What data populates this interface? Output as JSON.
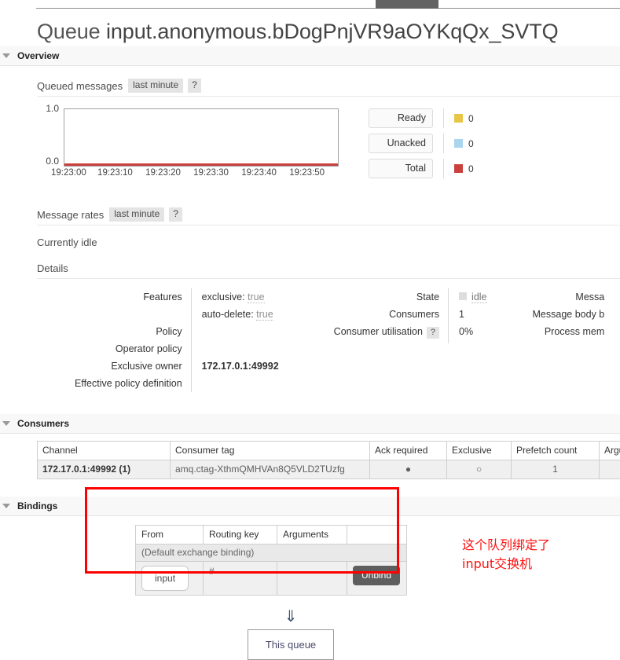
{
  "topbar": {
    "active_tab_marker": ""
  },
  "page": {
    "title_prefix": "Queue",
    "title_name": "input.anonymous.bDogPnjVR9aOYKqQx_SVTQ"
  },
  "overview": {
    "section_label": "Overview",
    "queued_messages": {
      "label": "Queued messages",
      "period_chip": "last minute",
      "help_chip": "?"
    },
    "message_rates": {
      "label": "Message rates",
      "period_chip": "last minute",
      "help_chip": "?"
    },
    "idle_text": "Currently idle",
    "details_label": "Details"
  },
  "chart_data": {
    "type": "line",
    "title": "Queued messages",
    "xlabel": "",
    "ylabel": "",
    "x": [
      "19:23:00",
      "19:23:10",
      "19:23:20",
      "19:23:30",
      "19:23:40",
      "19:23:50"
    ],
    "ytick_labels": [
      "0.0",
      "1.0"
    ],
    "ylim": [
      0,
      1
    ],
    "grid": false,
    "legend_position": "right",
    "series": [
      {
        "name": "Ready",
        "color": "#e8c547",
        "value": "0",
        "values": [
          0,
          0,
          0,
          0,
          0,
          0
        ]
      },
      {
        "name": "Unacked",
        "color": "#a9d5ef",
        "value": "0",
        "values": [
          0,
          0,
          0,
          0,
          0,
          0
        ]
      },
      {
        "name": "Total",
        "color": "#c9403c",
        "value": "0",
        "values": [
          0,
          0,
          0,
          0,
          0,
          0
        ]
      }
    ]
  },
  "details": {
    "col1": {
      "keys": [
        "Features",
        "",
        "Policy",
        "Operator policy",
        "Exclusive owner",
        "Effective policy definition"
      ],
      "values": [
        {
          "key": "exclusive:",
          "val": "true"
        },
        {
          "key": "auto-delete:",
          "val": "true"
        },
        {
          "key": "",
          "val": ""
        },
        {
          "key": "",
          "val": ""
        },
        {
          "key": "172.17.0.1:49992",
          "val": ""
        },
        {
          "key": "",
          "val": ""
        }
      ]
    },
    "col2": {
      "keys": [
        "State",
        "Consumers",
        "Consumer utilisation"
      ],
      "util_help": "?",
      "values": [
        "idle",
        "1",
        "0%"
      ]
    },
    "col3": {
      "keys": [
        "Messa",
        "Message body b",
        "Process mem"
      ]
    }
  },
  "consumers": {
    "section_label": "Consumers",
    "headers": [
      "Channel",
      "Consumer tag",
      "Ack required",
      "Exclusive",
      "Prefetch count",
      "Arguments"
    ],
    "rows": [
      {
        "channel": "172.17.0.1:49992 (1)",
        "consumer_tag": "amq.ctag-XthmQMHVAn8Q5VLD2TUzfg",
        "ack_required": "●",
        "exclusive": "○",
        "prefetch_count": "1",
        "arguments": ""
      }
    ]
  },
  "bindings": {
    "section_label": "Bindings",
    "headers": [
      "From",
      "Routing key",
      "Arguments",
      ""
    ],
    "default_row": "(Default exchange binding)",
    "rows": [
      {
        "from": "input",
        "routing_key": "#",
        "arguments": "",
        "action": "Unbind"
      }
    ],
    "annotation": {
      "line1": "这个队列绑定了",
      "line2": "input交换机",
      "color": "#ff1010"
    },
    "arrow_glyph": "⇓",
    "this_queue_label": "This queue"
  }
}
